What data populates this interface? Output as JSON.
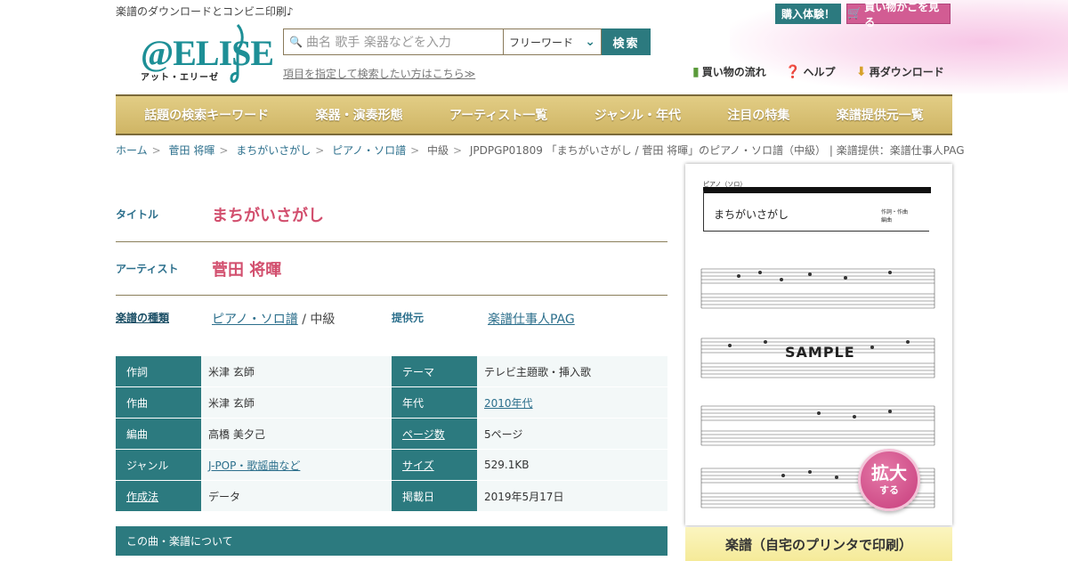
{
  "header": {
    "tagline": "楽譜のダウンロードとコンビニ印刷♪",
    "logo_text": "@ELISE",
    "logo_sub": "アット・エリーゼ",
    "search_placeholder": "曲名 歌手 楽器などを入力",
    "search_mode": "フリーワード",
    "search_button": "検索",
    "advanced_link": "項目を指定して検索したい方はこちら≫",
    "trial_button": "購入体験！",
    "cart_button": "買い物かごを見る",
    "help_links": [
      "買い物の流れ",
      "ヘルプ",
      "再ダウンロード"
    ]
  },
  "nav": [
    "話題の検索キーワード",
    "楽器・演奏形態",
    "アーティスト一覧",
    "ジャンル・年代",
    "注目の特集",
    "楽譜提供元一覧"
  ],
  "breadcrumb": {
    "links": [
      "ホーム",
      "菅田 将暉",
      "まちがいさがし",
      "ピアノ・ソロ譜"
    ],
    "level": "中級",
    "current": "JPDPGP01809 「まちがいさがし / 菅田 将暉」のピアノ・ソロ譜（中級） | 楽譜提供：楽譜仕事人PAG"
  },
  "detail": {
    "title_label": "タイトル",
    "title": "まちがいさがし",
    "artist_label": "アーティスト",
    "artist": "菅田 将暉",
    "type_label": "楽譜の種類",
    "type_link": "ピアノ・ソロ譜",
    "type_level": " / 中級",
    "provider_label": "提供元",
    "provider": "楽譜仕事人PAG"
  },
  "info": [
    {
      "l": "作詞",
      "v": "米津 玄師",
      "l2": "テーマ",
      "v2": "テレビ主題歌・挿入歌"
    },
    {
      "l": "作曲",
      "v": "米津 玄師",
      "l2": "年代",
      "v2": "2010年代"
    },
    {
      "l": "編曲",
      "v": "高橋 美夕己",
      "l2": "ページ数",
      "v2": "5ページ"
    },
    {
      "l": "ジャンル",
      "v": "J-POP・歌謡曲など",
      "l2": "サイズ",
      "v2": "529.1KB"
    },
    {
      "l": "作成法",
      "v": "データ",
      "l2": "掲載日",
      "v2": "2019年5月17日"
    }
  ],
  "about_label": "この曲・楽譜について",
  "preview": {
    "part": "ピアノ（ソロ）",
    "title": "まちがいさがし",
    "credit1": "作詞・作曲",
    "credit2": "編曲",
    "sample": "SAMPLE",
    "zoom1": "拡大",
    "zoom2": "する"
  },
  "print_label": "楽譜（自宅のプリンタで印刷）"
}
